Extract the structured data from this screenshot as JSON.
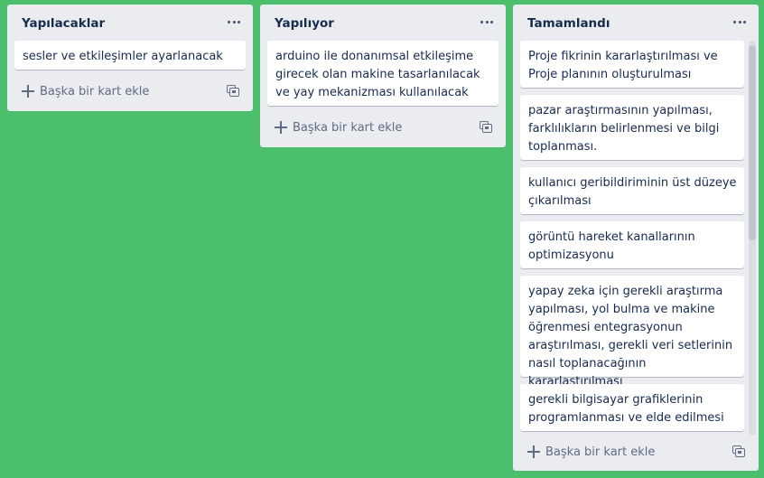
{
  "board": {
    "background_color": "#4bbf6b",
    "lists": [
      {
        "title": "Yapılacaklar",
        "cards": [
          "sesler ve etkileşimler ayarlanacak"
        ],
        "add_card_label": "Başka bir kart ekle"
      },
      {
        "title": "Yapılıyor",
        "cards": [
          "arduino ile donanımsal etkileşime girecek olan makine tasarlanılacak ve yay mekanizması kullanılacak"
        ],
        "add_card_label": "Başka bir kart ekle"
      },
      {
        "title": "Tamamlandı",
        "cards": [
          "Proje fikrinin kararlaştırılması ve Proje planının oluşturulması",
          "pazar araştırmasının yapılması, farklılıkların belirlenmesi ve bilgi toplanması.",
          "kullanıcı geribildiriminin üst düzeye çıkarılması",
          "görüntü hareket kanallarının optimizasyonu",
          "yapay zeka için gerekli araştırma yapılması, yol bulma ve makine öğrenmesi entegrasyonun araştırılması, gerekli veri setlerinin nasıl toplanacağının kararlaştırılması",
          "gerekli bilgisayar grafiklerinin programlanması ve elde edilmesi"
        ],
        "add_card_label": "Başka bir kart ekle"
      }
    ]
  },
  "icons": {
    "list_menu": "more-horizontal-icon",
    "add_card": "plus-icon",
    "card_template": "card-template-icon"
  }
}
